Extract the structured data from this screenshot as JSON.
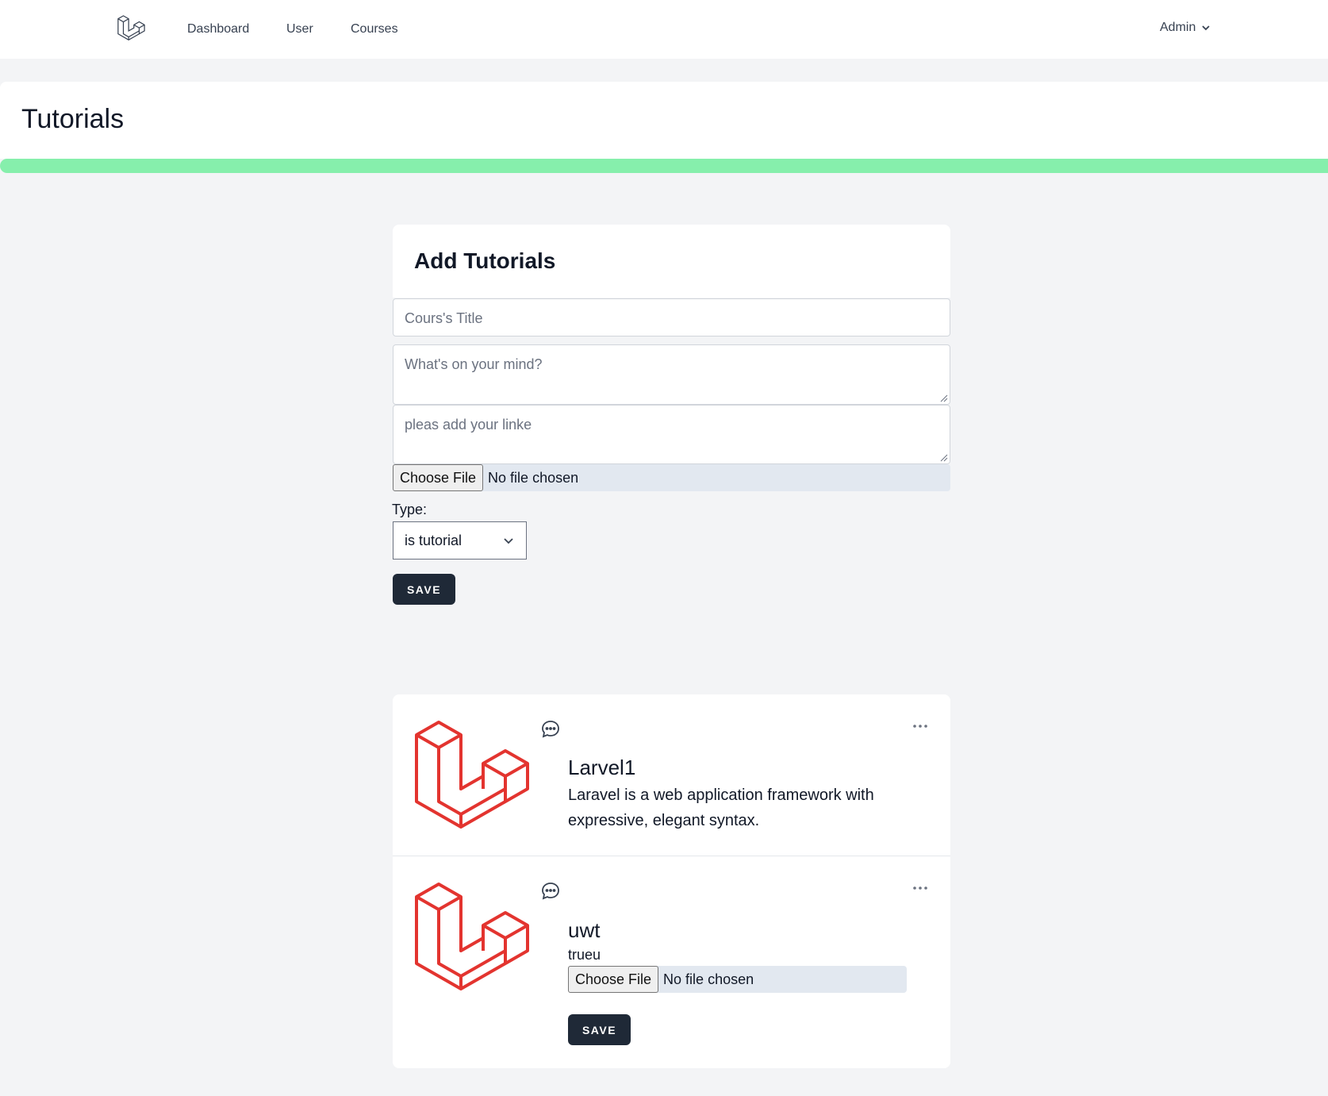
{
  "nav": {
    "links": [
      "Dashboard",
      "User",
      "Courses"
    ],
    "user_menu": "Admin"
  },
  "header": {
    "title": "Tutorials"
  },
  "form": {
    "title": "Add Tutorials",
    "course_title_placeholder": "Cours's Title",
    "mind_placeholder": "What's on your mind?",
    "link_placeholder": "pleas add your linke",
    "file_button": "Choose File",
    "file_status": "No file chosen",
    "type_label": "Type:",
    "type_value": "is tutorial",
    "save_label": "SAVE"
  },
  "posts": [
    {
      "title": "Larvel1",
      "body": "Laravel is a web application framework with expressive, elegant syntax."
    },
    {
      "title": "uwt",
      "subtitle": "trueu",
      "file_button": "Choose File",
      "file_status": "No file chosen",
      "save_label": "SAVE"
    }
  ],
  "colors": {
    "accent_bar": "#86efac",
    "button_bg": "#1f2937",
    "laravel_red": "#e3342f"
  },
  "icons": {
    "logo": "laravel-logo-icon",
    "dropdown": "chevron-down-icon",
    "comment": "chat-bubble-icon",
    "more": "ellipsis-icon"
  }
}
